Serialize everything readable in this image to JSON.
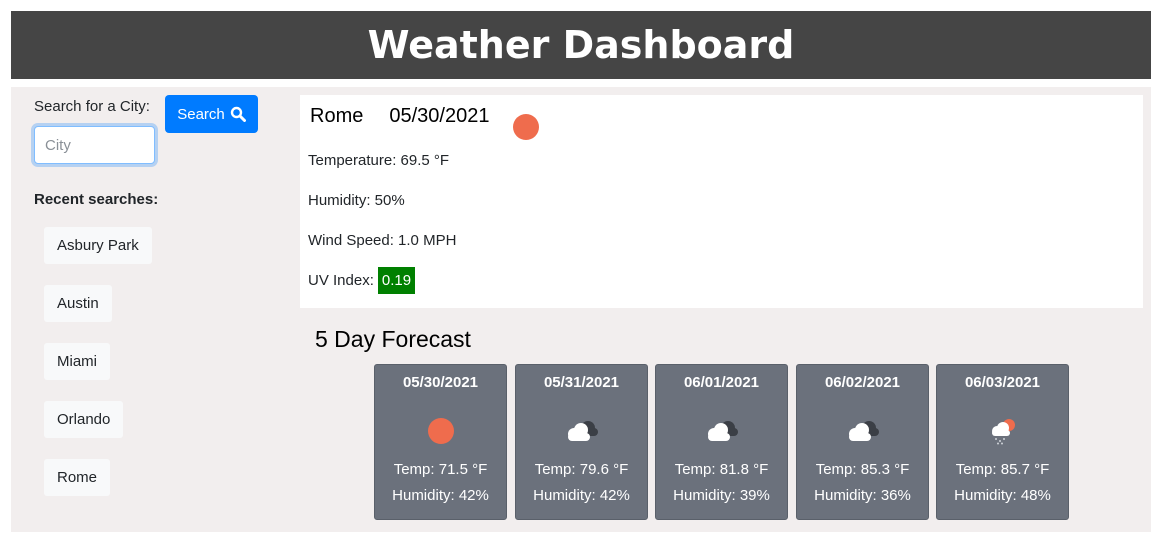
{
  "header": {
    "title": "Weather Dashboard"
  },
  "search": {
    "label": "Search for a City:",
    "placeholder": "City",
    "value": "",
    "button_label": "Search"
  },
  "recent": {
    "label": "Recent searches:",
    "items": [
      "Asbury Park",
      "Austin",
      "Miami",
      "Orlando",
      "Rome"
    ]
  },
  "current": {
    "city": "Rome",
    "date": "05/30/2021",
    "icon": "sun-icon",
    "temperature": "Temperature: 69.5 °F",
    "humidity": "Humidity: 50%",
    "wind": "Wind Speed: 1.0 MPH",
    "uv_label": "UV Index:",
    "uv_value": "0.19",
    "uv_color": "#008000"
  },
  "forecast": {
    "title": "5 Day Forecast",
    "days": [
      {
        "date": "05/30/2021",
        "icon": "sun-icon",
        "temp": "Temp: 71.5 °F",
        "humidity": "Humidity: 42%"
      },
      {
        "date": "05/31/2021",
        "icon": "cloud-icon",
        "temp": "Temp: 79.6 °F",
        "humidity": "Humidity: 42%"
      },
      {
        "date": "06/01/2021",
        "icon": "cloud-icon",
        "temp": "Temp: 81.8 °F",
        "humidity": "Humidity: 39%"
      },
      {
        "date": "06/02/2021",
        "icon": "cloud-icon",
        "temp": "Temp: 85.3 °F",
        "humidity": "Humidity: 36%"
      },
      {
        "date": "06/03/2021",
        "icon": "sun-rain-icon",
        "temp": "Temp: 85.7 °F",
        "humidity": "Humidity: 48%"
      }
    ]
  },
  "colors": {
    "header_bg": "#454545",
    "panel_bg": "#f2eeee",
    "card_bg": "#6b717c",
    "accent": "#007bff",
    "sun": "#ef6c4d"
  }
}
